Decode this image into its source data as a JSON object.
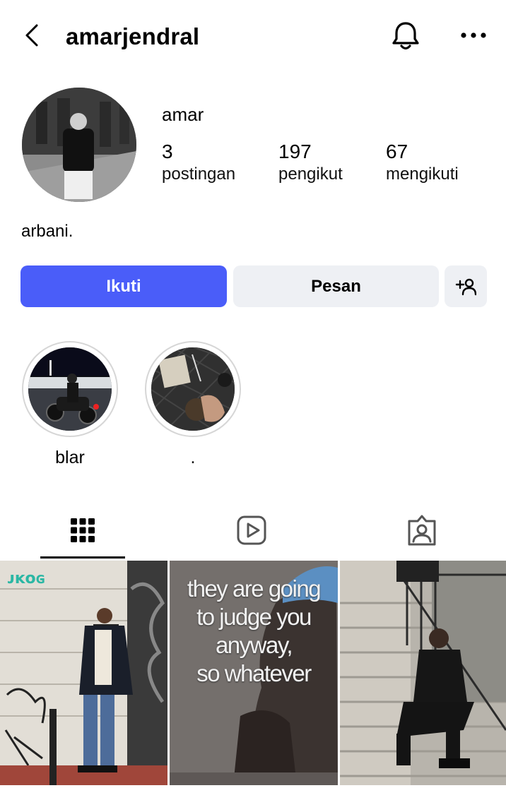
{
  "header": {
    "username": "amarjendral"
  },
  "profile": {
    "display_name": "amar",
    "stats": [
      {
        "value": "3",
        "label": "postingan"
      },
      {
        "value": "197",
        "label": "pengikut"
      },
      {
        "value": "67",
        "label": "mengikuti"
      }
    ],
    "bio": "arbani."
  },
  "actions": {
    "follow_label": "Ikuti",
    "message_label": "Pesan"
  },
  "highlights": [
    {
      "label": "blar"
    },
    {
      "label": "."
    }
  ],
  "tabs": [
    "grid-icon",
    "reels-icon",
    "tagged-icon"
  ],
  "posts": [
    {
      "caption": ""
    },
    {
      "overlay_text": [
        "they are going",
        "to judge you",
        "anyway,",
        "so whatever"
      ]
    },
    {
      "caption": ""
    }
  ],
  "colors": {
    "follow": "#4a5df9",
    "secondary_button": "#eef0f4"
  }
}
